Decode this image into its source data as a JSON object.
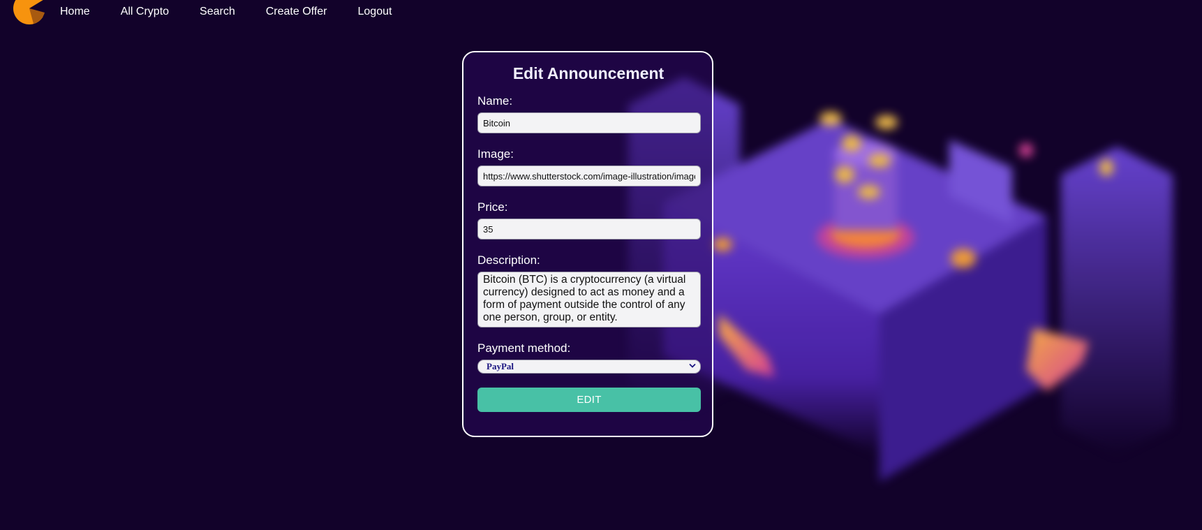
{
  "colors": {
    "page_background": "#12022a",
    "accent_button": "#48c1a6",
    "logo_orange": "#f7930e",
    "select_text": "#1a1580"
  },
  "nav": {
    "logo_icon": "crypto-logo-icon",
    "links": [
      {
        "label": "Home"
      },
      {
        "label": "All Crypto"
      },
      {
        "label": "Search"
      },
      {
        "label": "Create Offer"
      },
      {
        "label": "Logout"
      }
    ]
  },
  "form": {
    "title": "Edit Announcement",
    "name": {
      "label": "Name:",
      "value": "Bitcoin"
    },
    "image": {
      "label": "Image:",
      "value": "https://www.shutterstock.com/image-illustration/image"
    },
    "price": {
      "label": "Price:",
      "value": "35"
    },
    "description": {
      "label": "Description:",
      "value": "Bitcoin (BTC) is a cryptocurrency (a virtual currency) designed to act as money and a form of payment outside the control of any one person, group, or entity."
    },
    "payment_method": {
      "label": "Payment method:",
      "selected": "PayPal"
    },
    "submit_label": "EDIT"
  }
}
